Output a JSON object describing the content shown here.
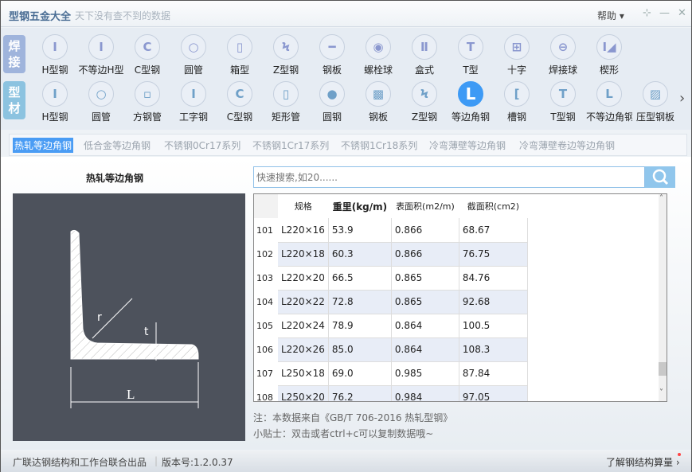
{
  "title": {
    "app": "型钢五金大全",
    "slogan": "天下没有查不到的数据",
    "help": "帮助 ▾",
    "pin": "⊹",
    "minimize": "—",
    "close": "✕"
  },
  "toolbar": {
    "weld_tab": "焊接",
    "profile_tab": "型材",
    "next": "›",
    "weld_items": [
      {
        "label": "H型钢",
        "glyph": "I"
      },
      {
        "label": "不等边H型",
        "glyph": "I"
      },
      {
        "label": "C型钢",
        "glyph": "C"
      },
      {
        "label": "圆管",
        "glyph": "○"
      },
      {
        "label": "箱型",
        "glyph": "▯"
      },
      {
        "label": "Z型钢",
        "glyph": "Ϟ"
      },
      {
        "label": "钢板",
        "glyph": "━"
      },
      {
        "label": "螺栓球",
        "glyph": "◉"
      },
      {
        "label": "盒式",
        "glyph": "Ⅱ"
      },
      {
        "label": "T型",
        "glyph": "T"
      },
      {
        "label": "十字",
        "glyph": "⊞"
      },
      {
        "label": "焊接球",
        "glyph": "⊖"
      },
      {
        "label": "楔形",
        "glyph": "I◢"
      }
    ],
    "profile_items": [
      {
        "label": "H型钢",
        "glyph": "I"
      },
      {
        "label": "圆管",
        "glyph": "○"
      },
      {
        "label": "方钢管",
        "glyph": "▫"
      },
      {
        "label": "工字钢",
        "glyph": "I"
      },
      {
        "label": "C型钢",
        "glyph": "C"
      },
      {
        "label": "矩形管",
        "glyph": "▯"
      },
      {
        "label": "圆钢",
        "glyph": "●"
      },
      {
        "label": "钢板",
        "glyph": "▩"
      },
      {
        "label": "Z型钢",
        "glyph": "Ϟ"
      },
      {
        "label": "等边角钢",
        "glyph": "L"
      },
      {
        "label": "槽钢",
        "glyph": "["
      },
      {
        "label": "T型钢",
        "glyph": "T"
      },
      {
        "label": "不等边角钢",
        "glyph": "L"
      },
      {
        "label": "压型钢板",
        "glyph": "▨"
      }
    ]
  },
  "subtabs": [
    "热轧等边角钢",
    "低合金等边角钢",
    "不锈钢0Cr17系列",
    "不锈钢1Cr17系列",
    "不锈钢1Cr18系列",
    "冷弯薄壁等边角钢",
    "冷弯薄壁卷边等边角钢"
  ],
  "shape_title": "热轧等边角钢",
  "diagram_labels": {
    "r": "r",
    "t": "t",
    "L": "L"
  },
  "search": {
    "placeholder": "快速搜索,如20......"
  },
  "table": {
    "headers": [
      "规格",
      "重里(kg/m)",
      "表面积(m2/m)",
      "截面积(cm2)"
    ],
    "rows": [
      [
        "101",
        "L220×16",
        "53.9",
        "0.866",
        "68.67"
      ],
      [
        "102",
        "L220×18",
        "60.3",
        "0.866",
        "76.75"
      ],
      [
        "103",
        "L220×20",
        "66.5",
        "0.865",
        "84.76"
      ],
      [
        "104",
        "L220×22",
        "72.8",
        "0.865",
        "92.68"
      ],
      [
        "105",
        "L220×24",
        "78.9",
        "0.864",
        "100.5"
      ],
      [
        "106",
        "L220×26",
        "85.0",
        "0.864",
        "108.3"
      ],
      [
        "107",
        "L250×18",
        "69.0",
        "0.985",
        "87.84"
      ],
      [
        "108",
        "L250×20",
        "76.2",
        "0.984",
        "97.05"
      ]
    ]
  },
  "notes": {
    "source": "注：本数据来自《GB/T 706-2016  热轧型钢》",
    "tip": "小贴士：双击或者ctrl+c可以复制数据哦~"
  },
  "footer": {
    "credit": "广联达钢结构和工作台联合出品",
    "version": "版本号:1.2.0.37",
    "learn": "了解钢结构算量 ›"
  },
  "colors": {
    "accent": "#3d9af5",
    "weld_tab": "#9fb4dc",
    "profile_tab": "#8cc3e0"
  }
}
